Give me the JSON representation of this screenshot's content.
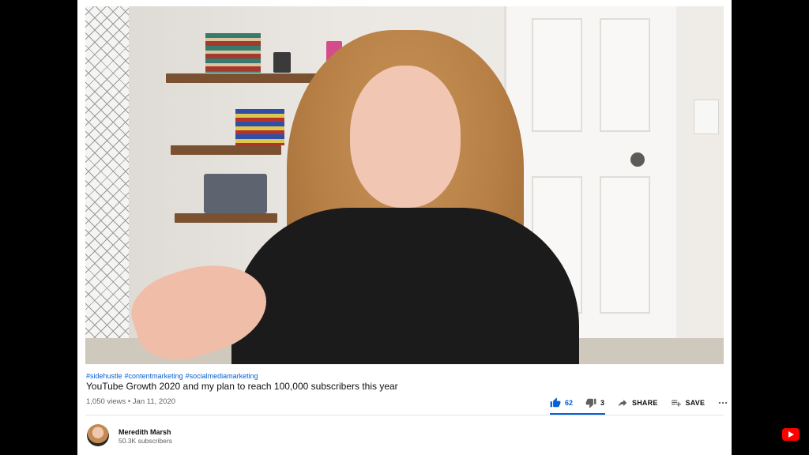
{
  "video": {
    "hashtags": [
      "#sidehustle",
      "#contentmarketing",
      "#socialmediamarketing"
    ],
    "title": "YouTube Growth 2020 and my plan to reach 100,000 subscribers this year",
    "views": "1,050 views",
    "separator": "•",
    "date": "Jan 11, 2020"
  },
  "actions": {
    "like_count": "62",
    "dislike_count": "3",
    "share_label": "SHARE",
    "save_label": "SAVE",
    "more_icon": "more-horizontal-icon",
    "like_icon": "thumbs-up-icon",
    "dislike_icon": "thumbs-down-icon",
    "share_icon": "share-arrow-icon",
    "save_icon": "playlist-add-icon"
  },
  "channel": {
    "name": "Meredith Marsh",
    "subscribers": "50.3K subscribers"
  },
  "colors": {
    "accent": "#065fd4",
    "brand": "#ff0000",
    "background": "#000000"
  }
}
